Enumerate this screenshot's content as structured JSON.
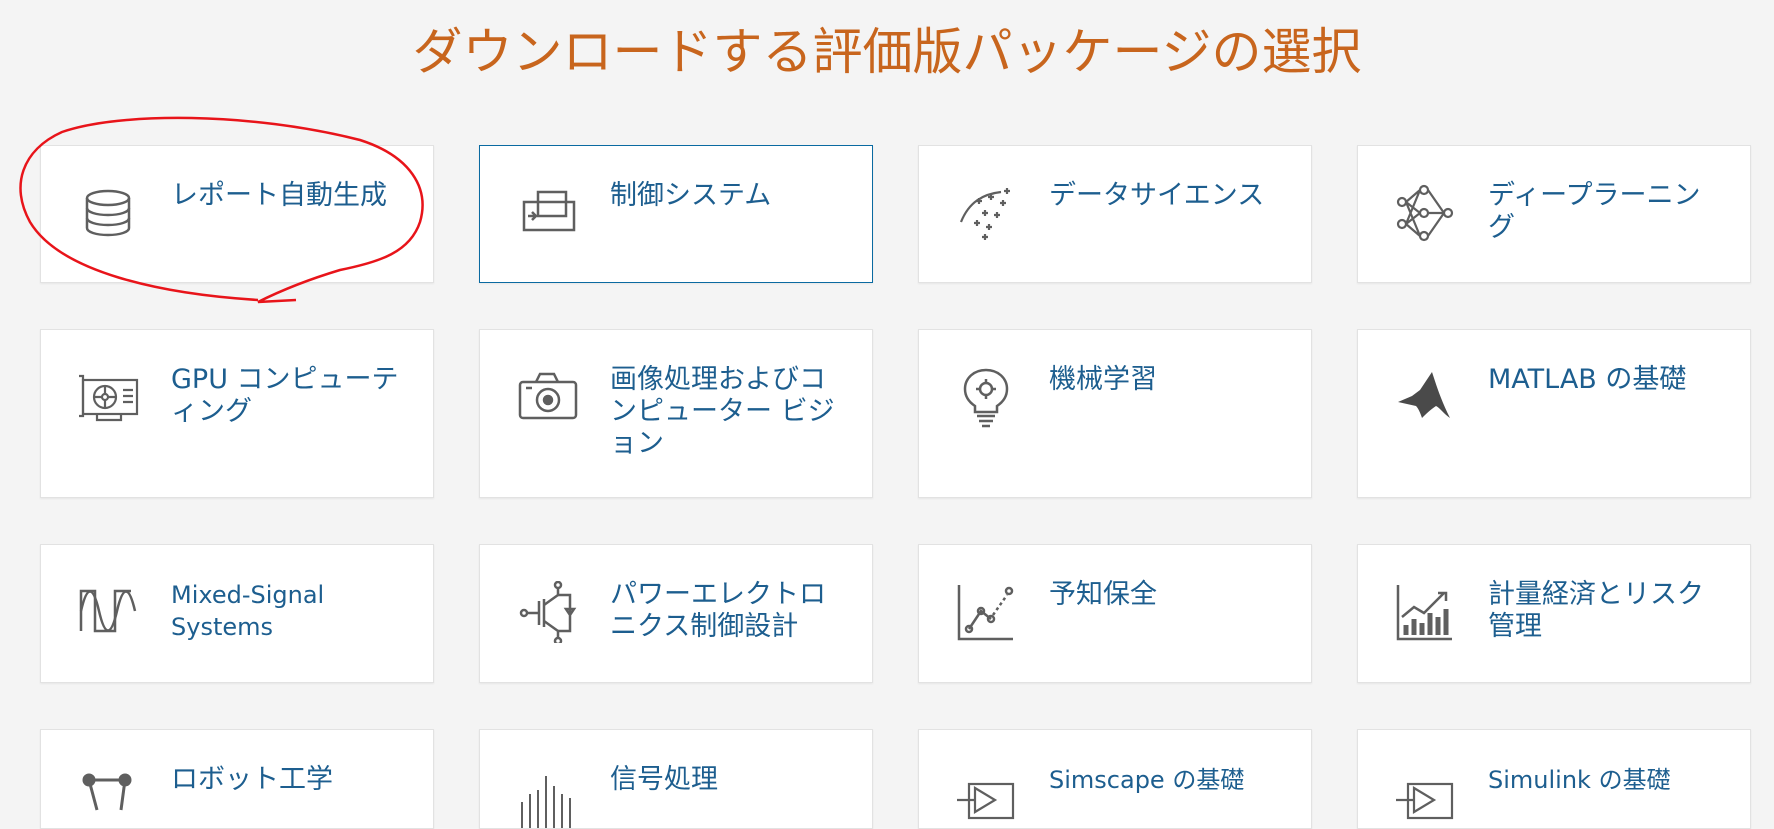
{
  "page": {
    "title": "ダウンロードする評価版パッケージの選択"
  },
  "cards": [
    {
      "label": "レポート自動生成",
      "icon": "database-icon"
    },
    {
      "label": "制御システム",
      "icon": "control-block-icon"
    },
    {
      "label": "データサイエンス",
      "icon": "scatter-sparkle-icon"
    },
    {
      "label": "ディープラーニング",
      "icon": "neural-network-icon"
    },
    {
      "label": "GPU コンピューティング",
      "icon": "gpu-card-icon"
    },
    {
      "label": "画像処理およびコンピューター ビジョン",
      "icon": "camera-icon"
    },
    {
      "label": "機械学習",
      "icon": "lightbulb-gear-icon"
    },
    {
      "label": "MATLAB の基礎",
      "icon": "matlab-logo-icon"
    },
    {
      "label": "Mixed-Signal Systems",
      "icon": "square-sine-wave-icon"
    },
    {
      "label": "パワーエレクトロニクス制御設計",
      "icon": "igbt-transistor-icon"
    },
    {
      "label": "予知保全",
      "icon": "trend-chart-icon"
    },
    {
      "label": "計量経済とリスク管理",
      "icon": "bar-trend-icon"
    },
    {
      "label": "ロボット工学",
      "icon": "robot-arm-icon"
    },
    {
      "label": "信号処理",
      "icon": "signal-bars-icon"
    },
    {
      "label": "Simscape の基礎",
      "icon": "simscape-block-icon"
    },
    {
      "label": "Simulink の基礎",
      "icon": "simulink-block-icon"
    }
  ],
  "colors": {
    "title": "#c8651d",
    "label": "#1d5e8f",
    "selected_border": "#0a6aa1",
    "annotation": "#e8141a"
  }
}
